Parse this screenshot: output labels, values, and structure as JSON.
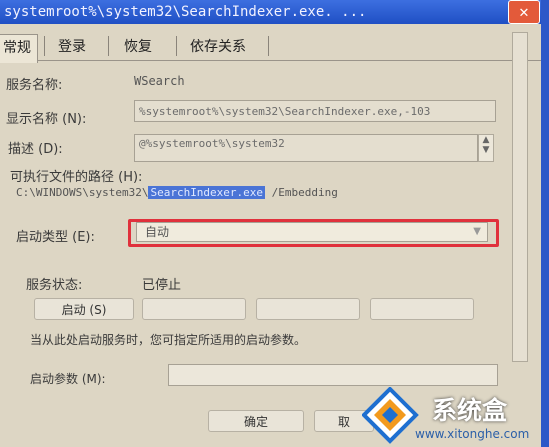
{
  "window": {
    "title": "systemroot%\\system32\\SearchIndexer.exe. ...",
    "close_glyph": "✕"
  },
  "tabs": [
    {
      "label": "常规",
      "active": true
    },
    {
      "label": "登录",
      "active": false
    },
    {
      "label": "恢复",
      "active": false
    },
    {
      "label": "依存关系",
      "active": false
    }
  ],
  "form": {
    "service_name_label": "服务名称:",
    "service_name_value": "WSearch",
    "display_name_label": "显示名称 (N):",
    "display_name_value": "%systemroot%\\system32\\SearchIndexer.exe,-103",
    "description_label": "描述 (D):",
    "description_value": "@%systemroot%\\system32",
    "exe_path_label": "可执行文件的路径 (H):",
    "exe_path_prefix": "C:\\WINDOWS\\system32\\",
    "exe_path_selected": "SearchIndexer.exe",
    "exe_path_suffix": " /Embedding",
    "startup_type_label": "启动类型 (E):",
    "startup_type_value": "自动",
    "service_status_label": "服务状态:",
    "service_status_value": "已停止",
    "hint_text": "当从此处启动服务时，您可指定所适用的启动参数。",
    "start_params_label": "启动参数 (M):",
    "start_params_value": ""
  },
  "buttons": {
    "start": "启动 (S)",
    "stop": "",
    "pause": "",
    "resume": "",
    "ok": "确定",
    "cancel": "取"
  },
  "watermark": {
    "title": "系统盒",
    "url": "www.xitonghe.com"
  },
  "colors": {
    "highlight_box": "#e0313c",
    "titlebar": "#2d5fd6",
    "selection": "#4a74d6"
  }
}
